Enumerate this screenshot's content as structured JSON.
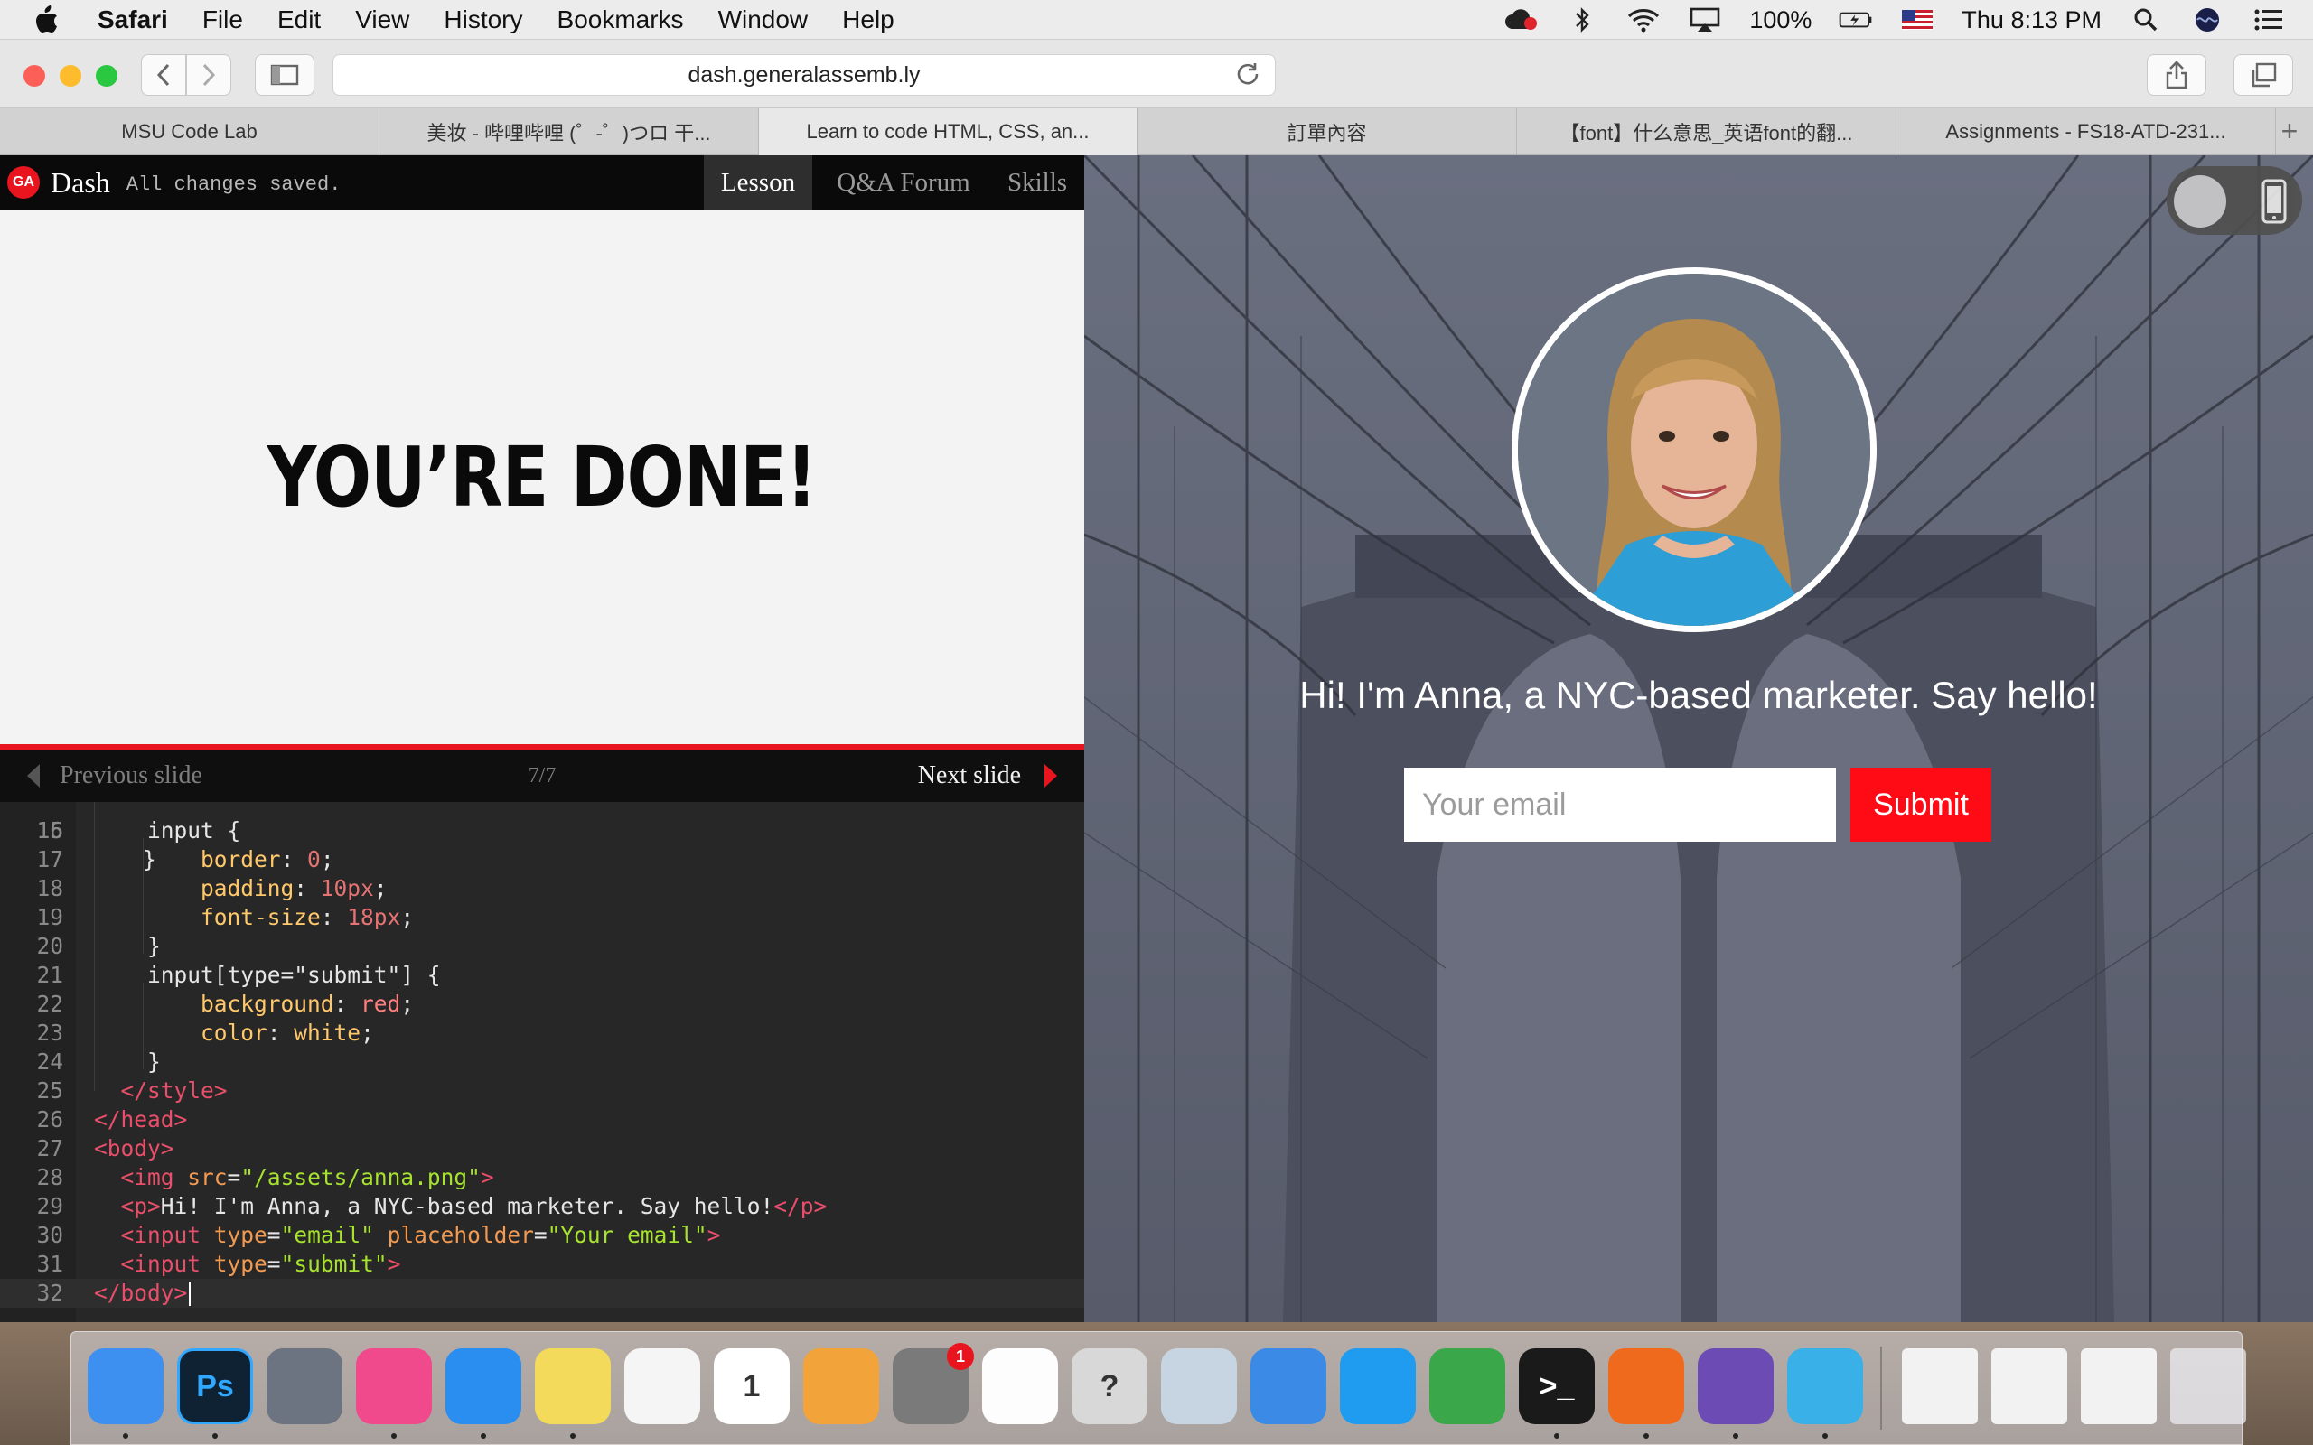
{
  "menubar": {
    "app_name": "Safari",
    "menus": [
      "File",
      "Edit",
      "View",
      "History",
      "Bookmarks",
      "Window",
      "Help"
    ],
    "battery": "100%",
    "clock": "Thu 8:13 PM"
  },
  "browser": {
    "url": "dash.generalassemb.ly",
    "tabs": [
      {
        "label": "MSU Code Lab"
      },
      {
        "label": "美妆 - 哔哩哔哩 (゜-゜)つロ 干..."
      },
      {
        "label": "Learn to code HTML, CSS, an...",
        "active": true
      },
      {
        "label": "訂單內容"
      },
      {
        "label": "【font】什么意思_英语font的翻..."
      },
      {
        "label": "Assignments - FS18-ATD-231..."
      }
    ]
  },
  "dash": {
    "logo": "GA",
    "title": "Dash",
    "status": "All changes saved.",
    "tabs": [
      "Lesson",
      "Q&A Forum",
      "Skills"
    ],
    "active_tab": "Lesson",
    "slide_heading": "YOU’RE DONE!",
    "prev_label": "Previous slide",
    "next_label": "Next slide",
    "slide_counter": "7/7"
  },
  "editor": {
    "partial_top_line": "15",
    "lines": [
      {
        "n": "16",
        "indent": "  ",
        "parts": [
          [
            "t-sel",
            "input {"
          ]
        ]
      },
      {
        "n": "17",
        "indent": "    ",
        "parts": [
          [
            "t-prop",
            "border"
          ],
          [
            "t-text",
            ": "
          ],
          [
            "t-num",
            "0"
          ],
          [
            "t-text",
            ";"
          ]
        ]
      },
      {
        "n": "18",
        "indent": "    ",
        "parts": [
          [
            "t-prop",
            "padding"
          ],
          [
            "t-text",
            ": "
          ],
          [
            "t-num",
            "10px"
          ],
          [
            "t-text",
            ";"
          ]
        ]
      },
      {
        "n": "19",
        "indent": "    ",
        "parts": [
          [
            "t-prop",
            "font-size"
          ],
          [
            "t-text",
            ": "
          ],
          [
            "t-num",
            "18px"
          ],
          [
            "t-text",
            ";"
          ]
        ]
      },
      {
        "n": "20",
        "indent": "  ",
        "parts": [
          [
            "t-text",
            "}"
          ]
        ]
      },
      {
        "n": "21",
        "indent": "  ",
        "parts": [
          [
            "t-sel",
            "input[type=\"submit\"] {"
          ]
        ]
      },
      {
        "n": "22",
        "indent": "    ",
        "parts": [
          [
            "t-prop",
            "background"
          ],
          [
            "t-text",
            ": "
          ],
          [
            "t-kw",
            "red"
          ],
          [
            "t-text",
            ";"
          ]
        ]
      },
      {
        "n": "23",
        "indent": "    ",
        "parts": [
          [
            "t-prop",
            "color"
          ],
          [
            "t-text",
            ": "
          ],
          [
            "t-prop",
            "white"
          ],
          [
            "t-text",
            ";"
          ]
        ]
      },
      {
        "n": "24",
        "indent": "  ",
        "parts": [
          [
            "t-text",
            "}"
          ]
        ]
      },
      {
        "n": "25",
        "indent": " ",
        "parts": [
          [
            "t-tag",
            "</style>"
          ]
        ]
      },
      {
        "n": "26",
        "indent": "",
        "parts": [
          [
            "t-tag",
            "</head>"
          ]
        ]
      },
      {
        "n": "27",
        "indent": "",
        "parts": [
          [
            "t-tag",
            "<body>"
          ]
        ]
      },
      {
        "n": "28",
        "indent": " ",
        "parts": [
          [
            "t-tag",
            "<img "
          ],
          [
            "t-attr",
            "src"
          ],
          [
            "t-text",
            "="
          ],
          [
            "t-str",
            "\"/assets/anna.png\""
          ],
          [
            "t-tag",
            ">"
          ]
        ]
      },
      {
        "n": "29",
        "indent": " ",
        "parts": [
          [
            "t-tag",
            "<p>"
          ],
          [
            "t-text",
            "Hi! I'm Anna, a NYC-based marketer. Say hello!"
          ],
          [
            "t-tag",
            "</p>"
          ]
        ]
      },
      {
        "n": "30",
        "indent": " ",
        "parts": [
          [
            "t-tag",
            "<input "
          ],
          [
            "t-attr",
            "type"
          ],
          [
            "t-text",
            "="
          ],
          [
            "t-str",
            "\"email\""
          ],
          [
            "t-text",
            " "
          ],
          [
            "t-attr",
            "placeholder"
          ],
          [
            "t-text",
            "="
          ],
          [
            "t-str",
            "\"Your email\""
          ],
          [
            "t-tag",
            ">"
          ]
        ]
      },
      {
        "n": "31",
        "indent": " ",
        "parts": [
          [
            "t-tag",
            "<input "
          ],
          [
            "t-attr",
            "type"
          ],
          [
            "t-text",
            "="
          ],
          [
            "t-str",
            "\"submit\""
          ],
          [
            "t-tag",
            ">"
          ]
        ]
      },
      {
        "n": "32",
        "indent": "",
        "parts": [
          [
            "t-tag",
            "</body>"
          ]
        ],
        "current": true
      }
    ]
  },
  "preview": {
    "intro": "Hi! I'm Anna, a NYC-based marketer. Say hello!",
    "email_placeholder": "Your email",
    "submit_label": "Submit"
  },
  "colors": {
    "ga_red": "#e8141e",
    "submit_red": "#fe0b15"
  },
  "dock": {
    "apps": [
      {
        "icon": "finder-icon",
        "color": "#3d8ff0",
        "running": true
      },
      {
        "icon": "photoshop-icon",
        "label": "Ps",
        "color": "#0f2233",
        "running": true
      },
      {
        "icon": "launchpad-icon",
        "color": "#6b7480",
        "running": false
      },
      {
        "icon": "itunes-icon",
        "color": "#f04a8c",
        "running": true
      },
      {
        "icon": "safari-icon",
        "color": "#2a8ef0",
        "running": true
      },
      {
        "icon": "notes-icon",
        "color": "#f4da5a",
        "running": true
      },
      {
        "icon": "reminders-icon",
        "color": "#f5f5f5",
        "running": false
      },
      {
        "icon": "calendar-icon",
        "label": "1",
        "color": "#ffffff",
        "running": false
      },
      {
        "icon": "pages-icon",
        "color": "#f2a33a",
        "running": false
      },
      {
        "icon": "system-preferences-icon",
        "badge": "1",
        "color": "#7a7a7a",
        "running": false
      },
      {
        "icon": "photos-icon",
        "color": "#fdfdfd",
        "running": false
      },
      {
        "icon": "help-icon",
        "label": "?",
        "color": "#d8d8d8",
        "running": false
      },
      {
        "icon": "preview-icon",
        "color": "#c7d4e2",
        "running": false
      },
      {
        "icon": "keynote-icon",
        "color": "#3b8ae6",
        "running": false
      },
      {
        "icon": "app-store-icon",
        "color": "#1f9bf0",
        "running": false
      },
      {
        "icon": "numbers-icon",
        "color": "#3aa84a",
        "running": false
      },
      {
        "icon": "terminal-icon",
        "label": ">_",
        "color": "#1a1a1a",
        "running": true
      },
      {
        "icon": "firefox-icon",
        "color": "#f06a1d",
        "running": true
      },
      {
        "icon": "github-icon",
        "color": "#6c4bb5",
        "running": true
      },
      {
        "icon": "infuse-icon",
        "color": "#39b0e8",
        "running": true
      }
    ],
    "stacks": [
      {
        "icon": "document-stack-icon"
      },
      {
        "icon": "screenshot-stack-icon"
      },
      {
        "icon": "downloads-stack-icon"
      },
      {
        "icon": "trash-icon"
      }
    ]
  }
}
